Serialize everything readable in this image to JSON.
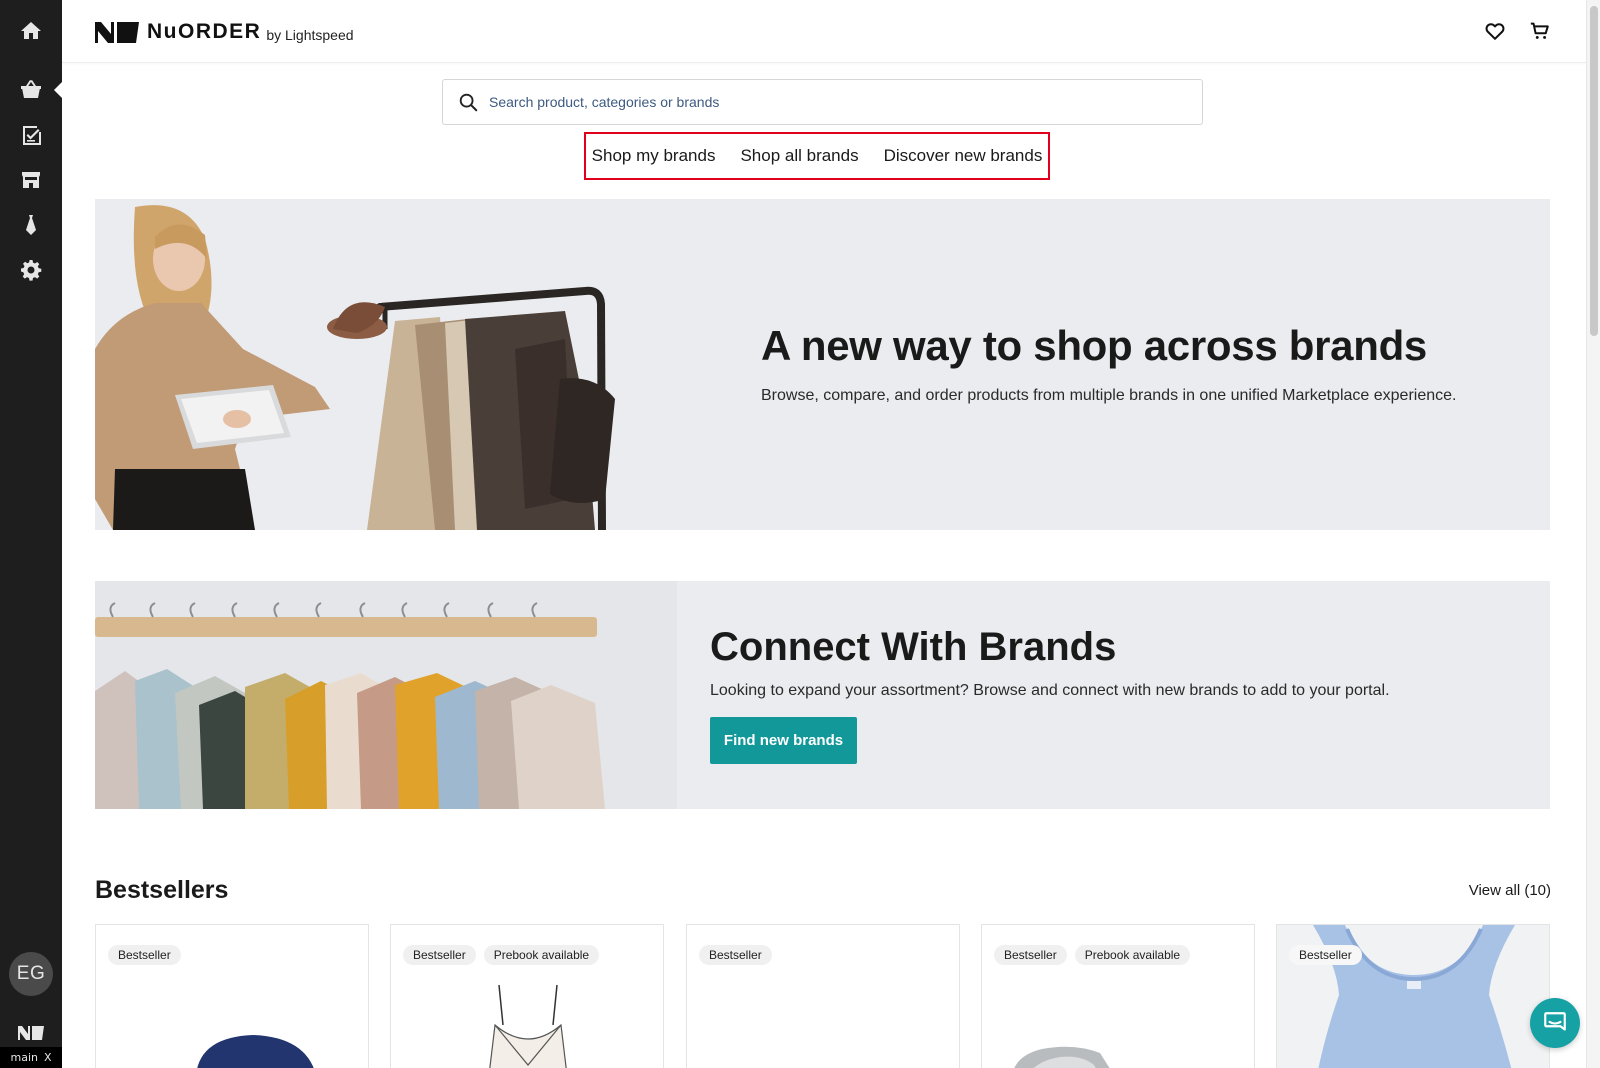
{
  "sidebar": {
    "items": [
      {
        "name": "home-icon",
        "active": false
      },
      {
        "name": "shopping-basket-icon",
        "active": true
      },
      {
        "name": "checklist-icon",
        "active": false
      },
      {
        "name": "storefront-icon",
        "active": false
      },
      {
        "name": "tie-icon",
        "active": false
      },
      {
        "name": "gear-icon",
        "active": false
      }
    ],
    "avatar_initials": "EG",
    "tag_label": "main",
    "tag_close": "X"
  },
  "header": {
    "logo_word": "NuORDER",
    "logo_sub": "by Lightspeed",
    "icons": [
      "heart-icon",
      "cart-icon"
    ]
  },
  "search": {
    "placeholder": "Search product, categories or brands"
  },
  "brand_nav": {
    "items": [
      "Shop my brands",
      "Shop all brands",
      "Discover new brands"
    ],
    "highlight_color": "#e0001b"
  },
  "hero_primary": {
    "title": "A new way to shop across brands",
    "subtitle": "Browse, compare, and order products from multiple brands in one unified Marketplace experience."
  },
  "hero_connect": {
    "title": "Connect With Brands",
    "subtitle": "Looking to expand your assortment? Browse and connect with new brands to add to your portal.",
    "button_label": "Find new brands",
    "button_color": "#13989a"
  },
  "bestsellers": {
    "title": "Bestsellers",
    "view_all_label": "View all (10)",
    "cards": [
      {
        "badges": [
          "Bestseller"
        ]
      },
      {
        "badges": [
          "Bestseller",
          "Prebook available"
        ]
      },
      {
        "badges": [
          "Bestseller"
        ]
      },
      {
        "badges": [
          "Bestseller",
          "Prebook available"
        ]
      },
      {
        "badges": [
          "Bestseller"
        ]
      }
    ]
  }
}
